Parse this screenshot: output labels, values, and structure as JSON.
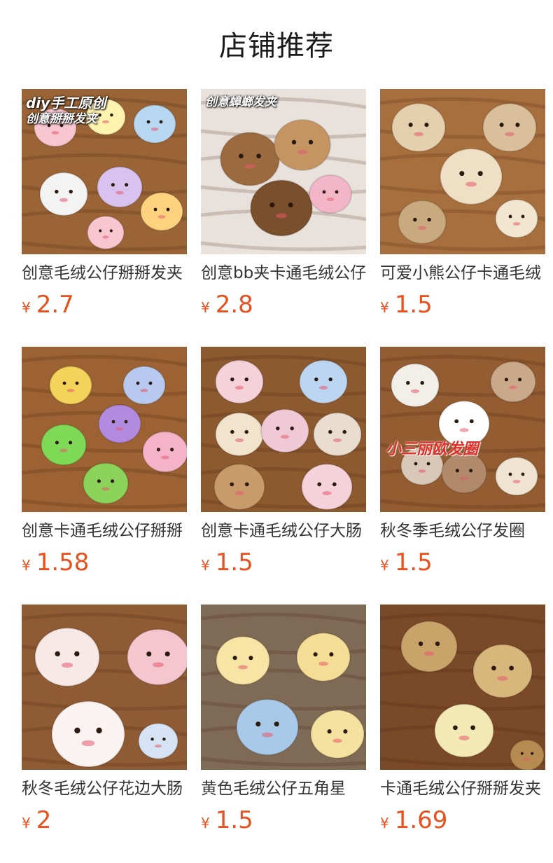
{
  "page": {
    "title": "店铺推荐"
  },
  "currency_symbol": "¥",
  "products": [
    {
      "name": "创意毛绒公仔掰掰发夹",
      "price": "2.7",
      "overlay_lines": [
        "diy手工原创",
        "创意掰掰发夹"
      ],
      "image_icon": "plush-hair-clips-photo",
      "bg": "#9a6436"
    },
    {
      "name": "创意bb夹卡通毛绒公仔",
      "price": "2.8",
      "overlay_lines": [
        "创意蟑螂发夹"
      ],
      "image_icon": "cockroach-plush-clips-photo",
      "bg": "#e9e2dc"
    },
    {
      "name": "可爱小熊公仔卡通毛绒",
      "price": "1.5",
      "overlay_lines": [],
      "image_icon": "bear-glasses-clips-photo",
      "bg": "#a86f3e"
    },
    {
      "name": "创意卡通毛绒公仔掰掰",
      "price": "1.58",
      "overlay_lines": [],
      "image_icon": "turtle-plush-clips-photo",
      "bg": "#9c6233"
    },
    {
      "name": "创意卡通毛绒公仔大肠",
      "price": "1.5",
      "overlay_lines": [],
      "image_icon": "scrunchie-plush-photo",
      "bg": "#8d5a30"
    },
    {
      "name": "秋冬季毛绒公仔发圈",
      "price": "1.5",
      "overlay_lines": [
        "小三丽欧发圈"
      ],
      "image_icon": "plaid-scrunchie-photo",
      "bg": "#935c31"
    },
    {
      "name": "秋冬毛绒公仔花边大肠",
      "price": "2",
      "overlay_lines": [],
      "image_icon": "lace-scrunchie-photo",
      "bg": "#8f5b34"
    },
    {
      "name": "黄色毛绒公仔五角星",
      "price": "1.5",
      "overlay_lines": [],
      "image_icon": "yellow-star-plush-photo",
      "bg": "#7f6a55"
    },
    {
      "name": "卡通毛绒公仔掰掰发夹",
      "price": "1.69",
      "overlay_lines": [],
      "image_icon": "teddy-bear-clips-photo",
      "bg": "#7a4a28"
    }
  ]
}
